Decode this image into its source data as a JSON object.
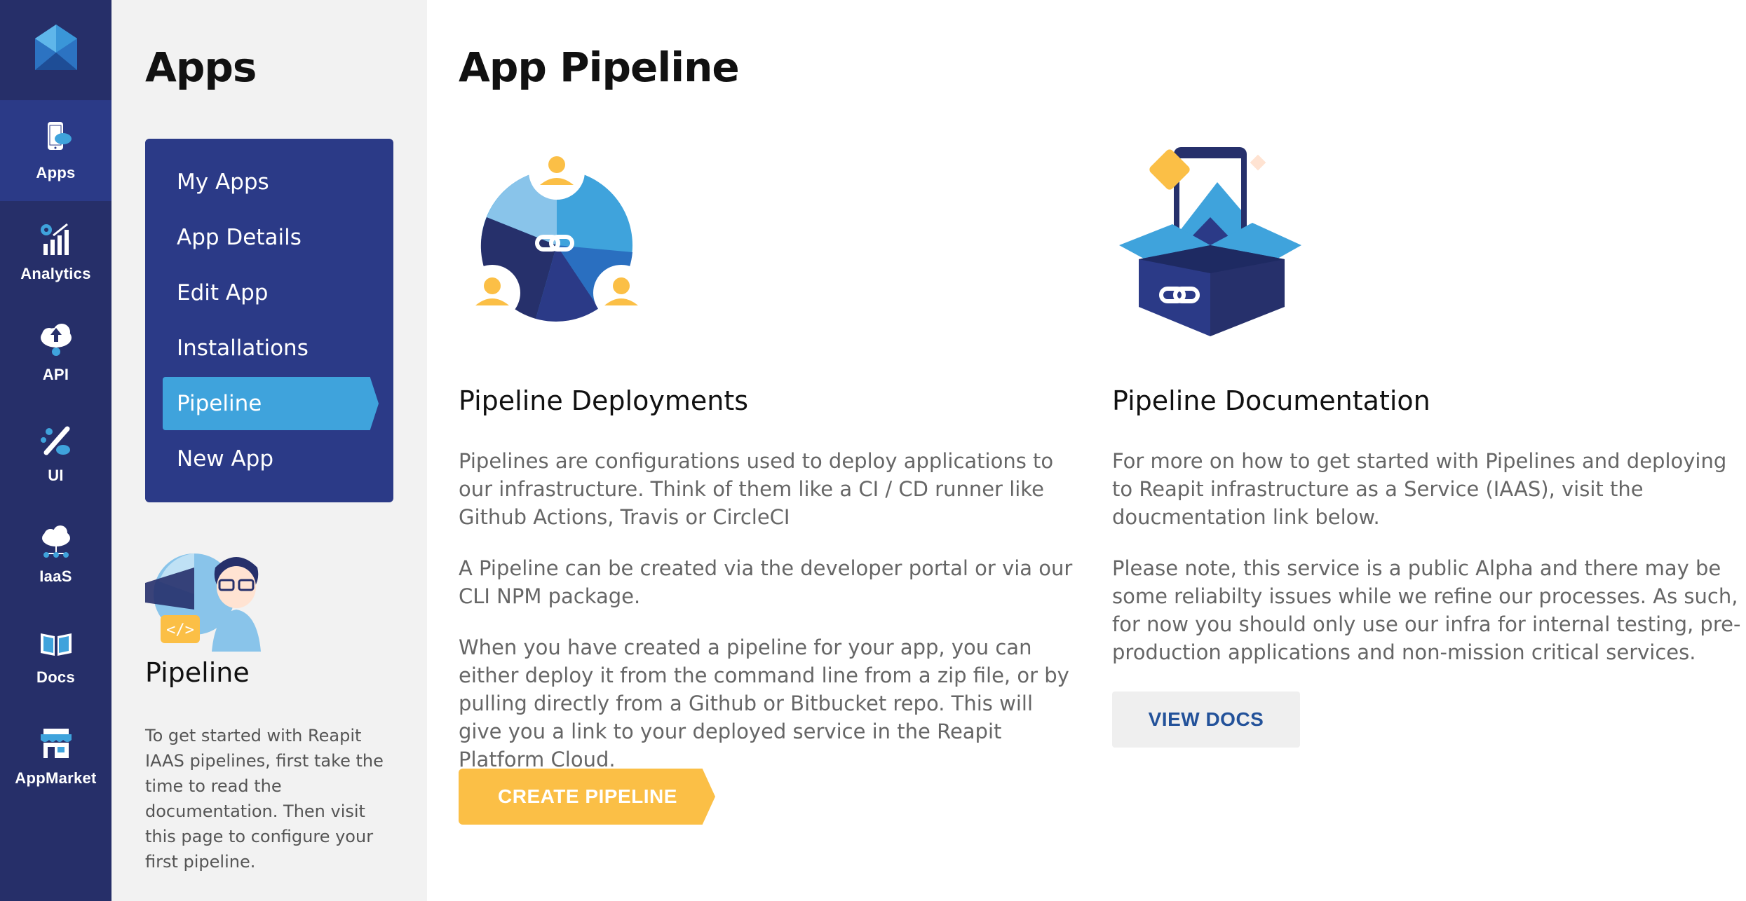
{
  "nav": {
    "items": [
      {
        "label": "Apps",
        "icon": "mobile-app-icon",
        "active": true
      },
      {
        "label": "Analytics",
        "icon": "analytics-icon",
        "active": false
      },
      {
        "label": "API",
        "icon": "cloud-upload-icon",
        "active": false
      },
      {
        "label": "UI",
        "icon": "paint-brush-icon",
        "active": false
      },
      {
        "label": "IaaS",
        "icon": "cloud-network-icon",
        "active": false
      },
      {
        "label": "Docs",
        "icon": "book-icon",
        "active": false
      },
      {
        "label": "AppMarket",
        "icon": "storefront-icon",
        "active": false
      }
    ]
  },
  "secondary": {
    "title": "Apps",
    "menu": [
      {
        "label": "My Apps"
      },
      {
        "label": "App Details"
      },
      {
        "label": "Edit App"
      },
      {
        "label": "Installations"
      },
      {
        "label": "Pipeline"
      },
      {
        "label": "New App"
      }
    ],
    "section_title": "Pipeline",
    "section_text": "To get started with Reapit IAAS pipelines, first take the time to read the documentation. Then visit this page to configure your first pipeline."
  },
  "main": {
    "title": "App Pipeline",
    "deployments": {
      "title": "Pipeline Deployments",
      "p1": "Pipelines are configurations used to deploy applications to our infrastructure. Think of them like a CI / CD runner like Github Actions, Travis or CircleCI",
      "p2": "A Pipeline can be created via the developer portal or via our CLI NPM package.",
      "p3": "When you have created a pipeline for your app, you can either deploy it from the command line from a zip file, or by pulling directly from a Github or Bitbucket repo. This will give you a link to your deployed service in the Reapit Platform Cloud.",
      "button": "CREATE PIPELINE"
    },
    "documentation": {
      "title": "Pipeline Documentation",
      "p1": "For more on how to get started with Pipelines and deploying to Reapit infrastructure as a Service (IAAS), visit the doucmentation link below.",
      "p2": "Please note, this service is a public Alpha and there may be some reliabilty issues while we refine our processes. As such, for now you should only use our infra for internal testing, pre-production applications and non-mission critical services.",
      "button": "VIEW DOCS"
    }
  },
  "colors": {
    "nav_bg": "#262f69",
    "nav_active": "#2b3a87",
    "menu_bg": "#2b3a87",
    "menu_active": "#3fa3dc",
    "accent_yellow": "#fbbf46",
    "docs_button_text": "#23529a"
  }
}
